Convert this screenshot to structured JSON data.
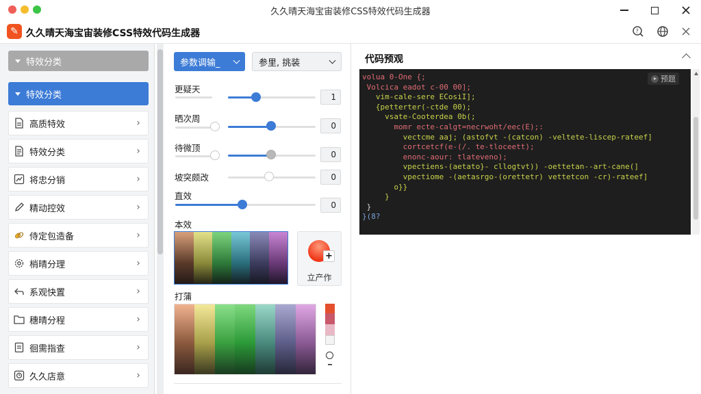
{
  "window": {
    "title": "久久晴天海宝宙装修CSS特效代码生成器"
  },
  "app": {
    "title": "久久晴天海宝宙装修CSS特效代码生成器",
    "logo_glyph": "✎"
  },
  "sidebar": {
    "category_gray": "特效分类",
    "category_active": "特效分类",
    "items": [
      {
        "label": "高质特效",
        "icon": "document-icon"
      },
      {
        "label": "特效分类",
        "icon": "list-document-icon"
      },
      {
        "label": "将忠分销",
        "icon": "chart-document-icon"
      },
      {
        "label": "精动控效",
        "icon": "pen-icon"
      },
      {
        "label": "侍定包造备",
        "icon": "link-icon"
      },
      {
        "label": "梢晴分理",
        "icon": "gear-icon"
      },
      {
        "label": "系观快置",
        "icon": "back-arrow-icon"
      },
      {
        "label": "穗晴分程",
        "icon": "folder-icon"
      },
      {
        "label": "徊需指查",
        "icon": "document-edit-icon"
      },
      {
        "label": "久久店意",
        "icon": "clock-icon"
      }
    ]
  },
  "toolbar": {
    "primary_label": "参数调输_",
    "secondary_label": "参里, 挑装"
  },
  "params": [
    {
      "label": "更疑天",
      "value": "1",
      "level": 0.32
    },
    {
      "label": "晒次周",
      "value": "0",
      "level": 0.5
    },
    {
      "label": "待微顶",
      "value": "0",
      "level": 0.5
    },
    {
      "label": "坡突颇改",
      "value": "0",
      "level": 0.46
    },
    {
      "label": "直效",
      "value": "0",
      "level": 0.47
    }
  ],
  "palette": {
    "label": "本效",
    "picker_label": "立产作",
    "gradient_label": "打蒲"
  },
  "code": {
    "header": "代码预观",
    "preview_label": "预题",
    "lines": [
      {
        "text": "volua 0-One {;",
        "color": "#e06c75"
      },
      {
        "text": " Volcica eadot c-00 00];",
        "color": "#e06c75"
      },
      {
        "text": "   vim-cale-sere ECosiI];",
        "color": "#c9d34a"
      },
      {
        "text": "   {petterter(-ctde 00);",
        "color": "#c9d34a"
      },
      {
        "text": "     vsate-Cooterdea 0b(;",
        "color": "#c9d34a"
      },
      {
        "text": "       momr ecte-calgt=necrwoht/eec(E);:",
        "color": "#e06c75"
      },
      {
        "text": "         vectcme aaj; (astofvt -(catcon) -veltete-liscep-rateef]",
        "color": "#c9d34a"
      },
      {
        "text": "         cortcetcf(e-(/. te-tloceett);",
        "color": "#e06c75"
      },
      {
        "text": "         enonc-aour: tlateveno);",
        "color": "#e06c75"
      },
      {
        "text": "         vpectiens-(aetato}- cllogtvt)) -oettetan--art-cane(]",
        "color": "#c9d34a"
      },
      {
        "text": "         vpectiome -(aetasrgo-(orettetr) vettetcon -cr)-rateef]",
        "color": "#c9d34a"
      },
      {
        "text": "       o}}",
        "color": "#c9d34a"
      },
      {
        "text": "     }",
        "color": "#c9d34a"
      },
      {
        "text": " }",
        "color": "#dddddd"
      },
      {
        "text": "}(8?",
        "color": "#7aa2d6"
      }
    ]
  },
  "colors": {
    "accent": "#3c7bd6",
    "code_bg": "#1e1e1e"
  }
}
